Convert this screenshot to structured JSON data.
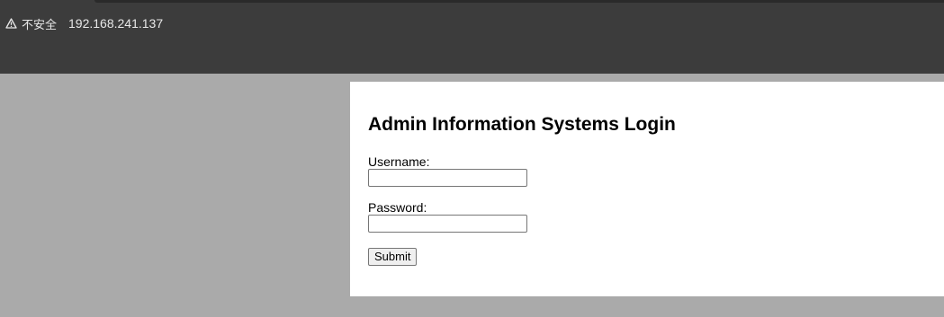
{
  "browser": {
    "security_icon": "warning-triangle-icon",
    "security_label": "不安全",
    "url": "192.168.241.137"
  },
  "page": {
    "title": "Admin Information Systems Login",
    "username_label": "Username:",
    "username_value": "",
    "password_label": "Password:",
    "password_value": "",
    "submit_label": "Submit"
  }
}
